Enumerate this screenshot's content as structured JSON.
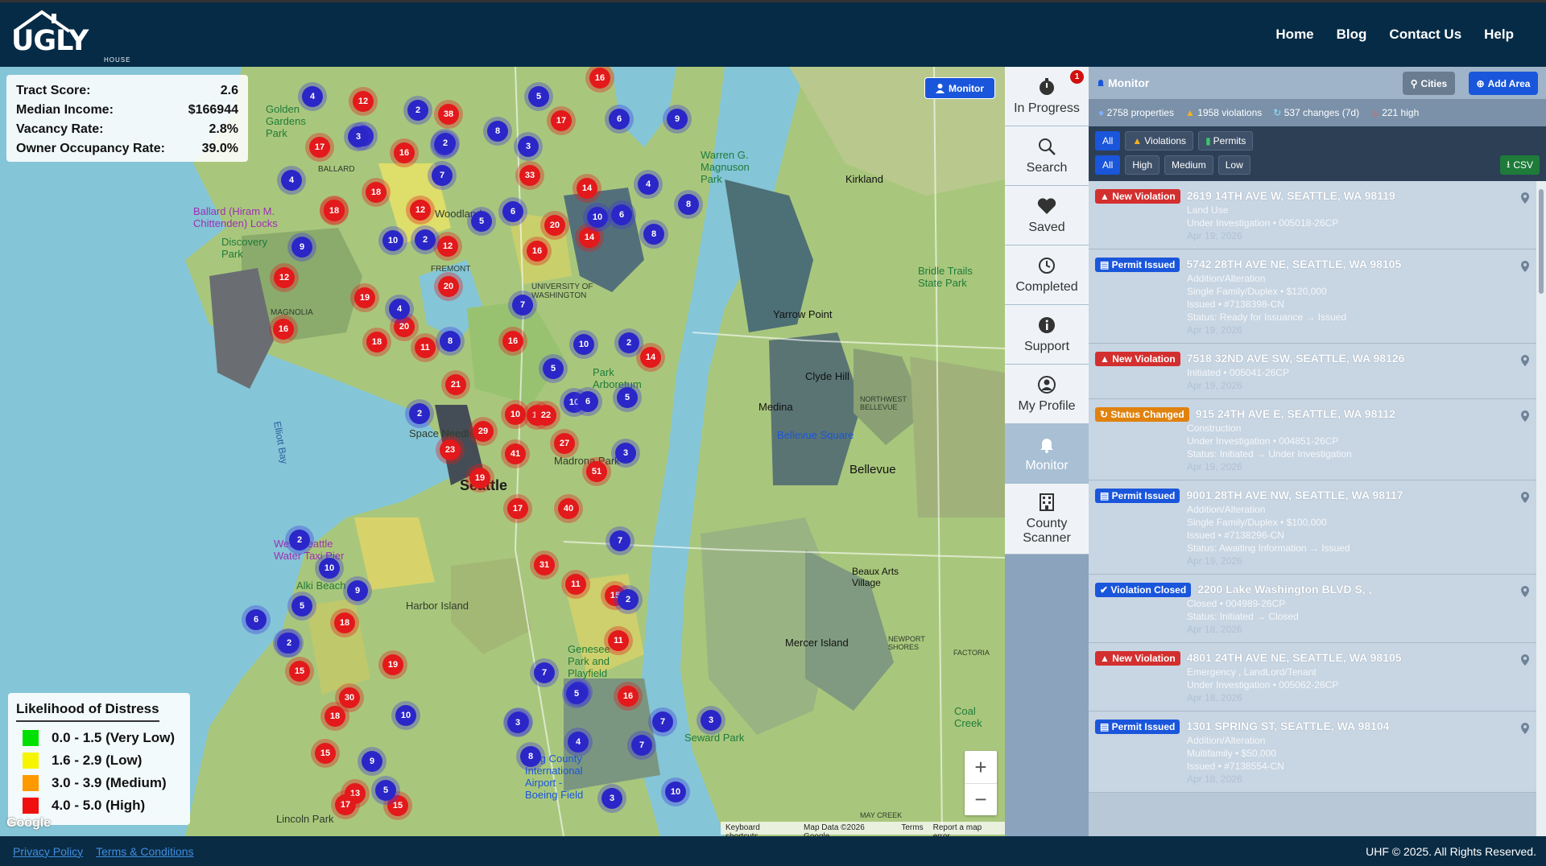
{
  "nav": {
    "home": "Home",
    "blog": "Blog",
    "contact": "Contact Us",
    "help": "Help"
  },
  "logo": {
    "word": "UGLY",
    "sub": "HOUSE FINDER"
  },
  "tract": {
    "score_label": "Tract Score:",
    "score": "2.6",
    "income_label": "Median Income:",
    "income": "$166944",
    "vacancy_label": "Vacancy Rate:",
    "vacancy": "2.8%",
    "owner_label": "Owner Occupancy Rate:",
    "owner": "39.0%"
  },
  "legend": {
    "title": "Likelihood of Distress",
    "items": [
      {
        "label": "0.0 - 1.5  (Very Low)",
        "color": "#00e000"
      },
      {
        "label": "1.6 - 2.9  (Low)",
        "color": "#f5f500"
      },
      {
        "label": "3.0 - 3.9  (Medium)",
        "color": "#ff9900"
      },
      {
        "label": "4.0 - 5.0  (High)",
        "color": "#f01010"
      }
    ]
  },
  "map": {
    "monitor_btn": "Monitor",
    "labels": {
      "seattle": "Seattle",
      "bellevue": "Bellevue",
      "kirkland": "Kirkland",
      "medina": "Medina",
      "clyde": "Clyde Hill",
      "yarrow": "Yarrow Point",
      "mercer": "Mercer Island",
      "beaux": "Beaux Arts Village",
      "harbor": "Harbor Island",
      "space": "Space Needle",
      "lincoln": "Lincoln Park",
      "magnolia": "MAGNOLIA",
      "ballard": "BALLARD",
      "fremont": "FREMONT",
      "uw": "UNIVERSITY OF WASHINGTON",
      "elliott": "Elliott Bay",
      "discovery": "Discovery Park",
      "golden": "Golden Gardens Park",
      "bellevuesq": "Bellevue Square",
      "bridle": "Bridle Trails State Park",
      "seward": "Seward Park",
      "westseattle": "West Seattle Water Taxi Pier",
      "alki": "Alki Beach",
      "genesee": "Genesee Park and Playfield",
      "kcia": "King County International Airport - Boeing Field",
      "warren": "Warren G. Magnuson Park",
      "arboretum": "Park Arboretum",
      "woodland": "Woodland",
      "madrona": "Madrona Park",
      "ballardlocks": "Ballard (Hiram M. Chittenden) Locks",
      "coal": "Coal Creek",
      "newport": "NEWPORT SHORES",
      "factoria": "FACTORIA",
      "nwbellevue": "NORTHWEST BELLEVUE",
      "mcreek": "MAY CREEK"
    },
    "attribution": [
      "Keyboard shortcuts",
      "Map Data ©2026 Google",
      "Terms",
      "Report a map error"
    ],
    "google": "Google",
    "clusters_red": [
      "16",
      "12",
      "17",
      "16",
      "38",
      "17",
      "18",
      "33",
      "14",
      "12",
      "20",
      "12",
      "18",
      "12",
      "20",
      "16",
      "14",
      "12",
      "19",
      "18",
      "16",
      "11",
      "20",
      "21",
      "16",
      "14",
      "18",
      "10",
      "22",
      "29",
      "27",
      "23",
      "41",
      "51",
      "19",
      "17",
      "40",
      "31",
      "11",
      "11",
      "18",
      "19",
      "16",
      "15",
      "30",
      "18",
      "15",
      "13",
      "15",
      "17",
      "15"
    ],
    "clusters_blue": [
      "4",
      "2",
      "3",
      "2",
      "5",
      "8",
      "3",
      "6",
      "9",
      "3",
      "2",
      "4",
      "7",
      "4",
      "5",
      "6",
      "10",
      "6",
      "8",
      "10",
      "2",
      "7",
      "9",
      "8",
      "10",
      "2",
      "4",
      "8",
      "5",
      "10",
      "2",
      "3",
      "6",
      "5",
      "7",
      "2",
      "10",
      "9",
      "5",
      "2",
      "7",
      "4",
      "10",
      "3",
      "5",
      "7",
      "3",
      "4",
      "8",
      "7",
      "3",
      "5",
      "3",
      "10",
      "9",
      "2",
      "6",
      "2"
    ]
  },
  "sidebar": {
    "items": [
      {
        "label": "In Progress",
        "badge": "1"
      },
      {
        "label": "Search"
      },
      {
        "label": "Saved"
      },
      {
        "label": "Completed"
      },
      {
        "label": "Support"
      },
      {
        "label": "My Profile"
      },
      {
        "label": "Monitor"
      },
      {
        "label": "County Scanner"
      }
    ]
  },
  "panel": {
    "title": "Monitor",
    "cities_btn": "Cities",
    "add_btn": "Add Area",
    "stats": {
      "properties": "2758 properties",
      "violations": "1958 violations",
      "changes": "537 changes (7d)",
      "high": "221 high"
    },
    "filter_type": [
      "All",
      "Violations",
      "Permits"
    ],
    "filter_level": [
      "All",
      "High",
      "Medium",
      "Low"
    ],
    "csv": "CSV",
    "cards": [
      {
        "type": "New Violation",
        "kind": "viol",
        "addr": "2619 14TH AVE W, SEATTLE, WA 98119",
        "lines": [
          "Land Use",
          "Under Investigation • 005018-26CP"
        ],
        "date": "Apr 19, 2026"
      },
      {
        "type": "Permit Issued",
        "kind": "perm",
        "addr": "5742 28TH AVE NE, SEATTLE, WA 98105",
        "lines": [
          "Addition/Alteration",
          "Single Family/Duplex • $120,000",
          "Issued • #7138398-CN",
          "Status: Ready for Issuance → Issued"
        ],
        "date": "Apr 19, 2026"
      },
      {
        "type": "New Violation",
        "kind": "viol",
        "addr": "7518 32ND AVE SW, SEATTLE, WA 98126",
        "lines": [
          "Initiated • 005041-26CP"
        ],
        "date": "Apr 19, 2026"
      },
      {
        "type": "Status Changed",
        "kind": "stat",
        "addr": "915 24TH AVE E, SEATTLE, WA 98112",
        "lines": [
          "Construction",
          "Under Investigation • 004851-26CP",
          "Status: Initiated → Under Investigation"
        ],
        "date": "Apr 19, 2026"
      },
      {
        "type": "Permit Issued",
        "kind": "perm",
        "addr": "9001 28TH AVE NW, SEATTLE, WA 98117",
        "lines": [
          "Addition/Alteration",
          "Single Family/Duplex • $100,000",
          "Issued • #7138296-CN",
          "Status: Awaiting Information → Issued"
        ],
        "date": "Apr 19, 2026"
      },
      {
        "type": "Violation Closed",
        "kind": "close",
        "addr": "2200 Lake Washington BLVD S, ,",
        "lines": [
          "Closed • 004989-26CP",
          "Status: Initiated → Closed"
        ],
        "date": "Apr 18, 2026"
      },
      {
        "type": "New Violation",
        "kind": "viol",
        "addr": "4801 24TH AVE NE, SEATTLE, WA 98105",
        "lines": [
          "Emergency , LandLord/Tenant",
          "Under Investigation • 005062-26CP"
        ],
        "date": "Apr 18, 2026"
      },
      {
        "type": "Permit Issued",
        "kind": "perm",
        "addr": "1301 SPRING ST, SEATTLE, WA 98104",
        "lines": [
          "Addition/Alteration",
          "Multifamily • $50,000",
          "Issued • #7138554-CN"
        ],
        "date": "Apr 18, 2026"
      }
    ]
  },
  "footer": {
    "privacy": "Privacy Policy",
    "terms": "Terms & Conditions",
    "copy": "UHF © 2025. All Rights Reserved."
  }
}
